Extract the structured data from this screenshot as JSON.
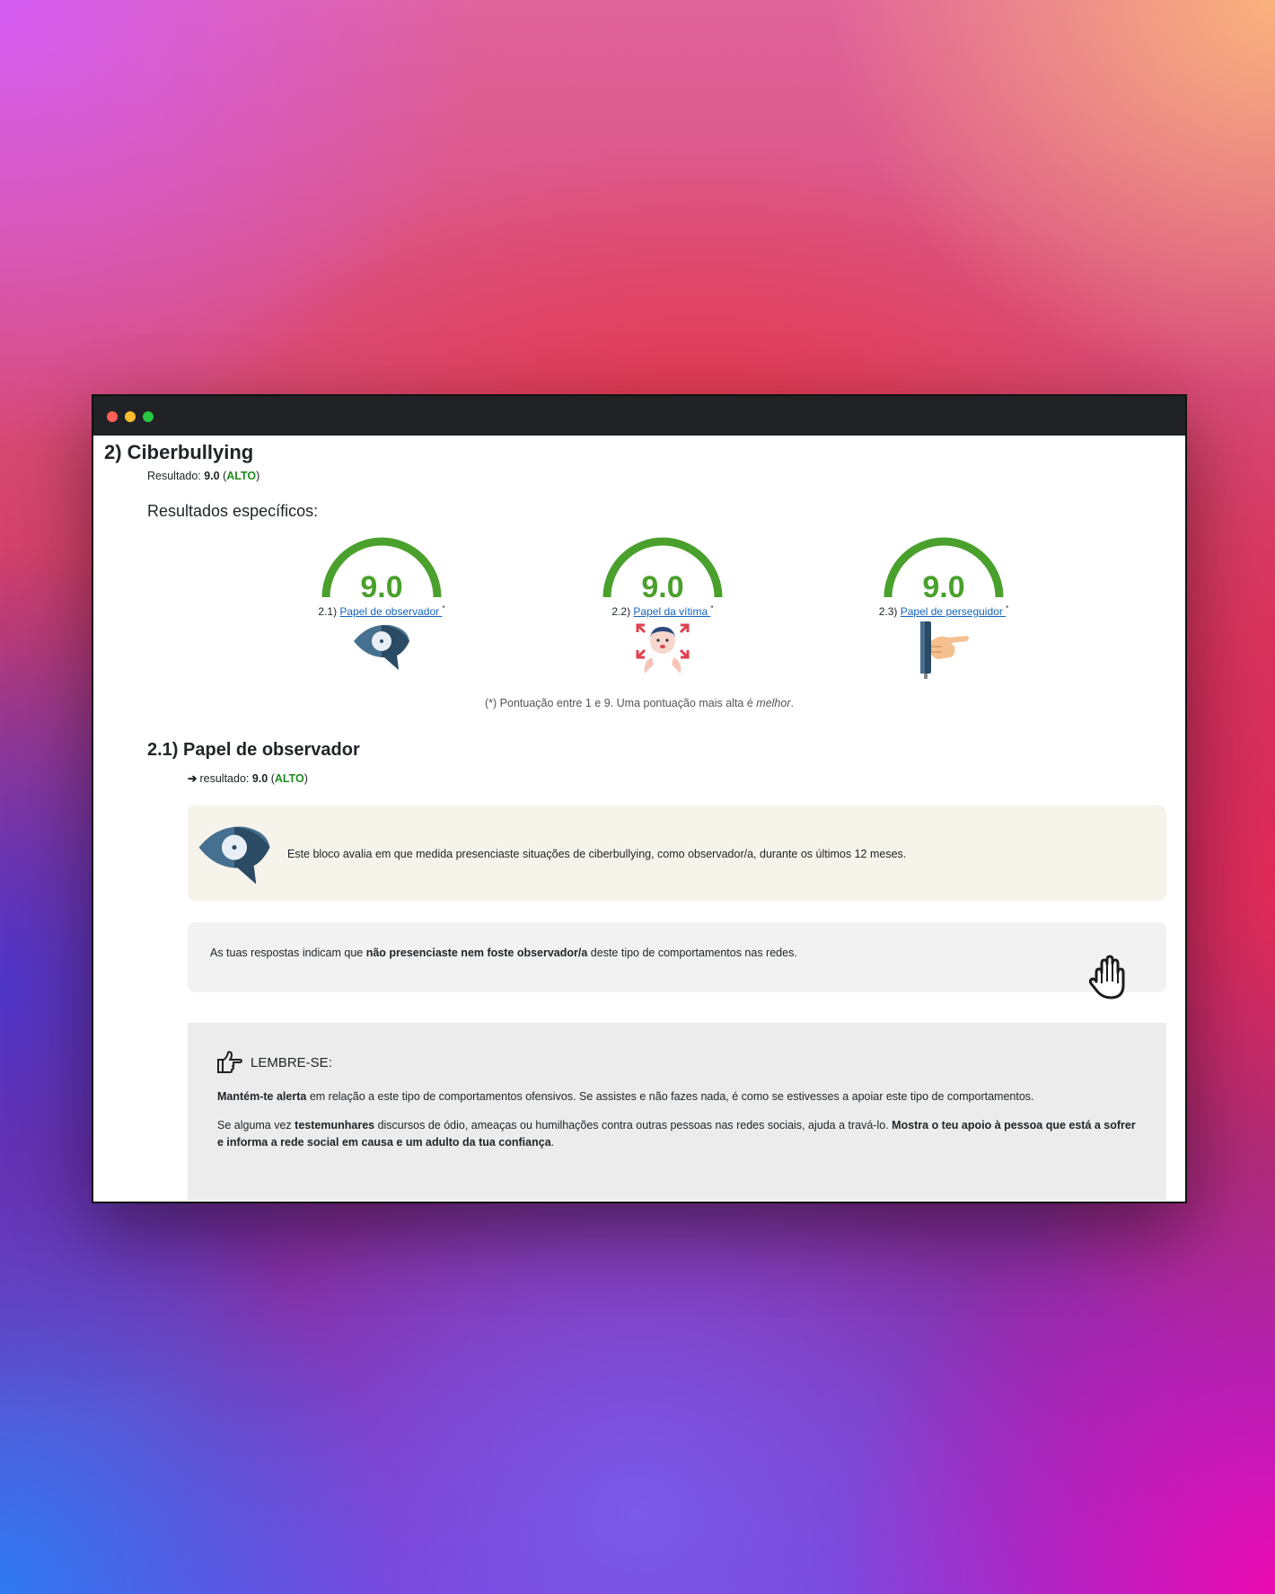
{
  "section": {
    "title": "2) Ciberbullying",
    "result_label": "Resultado: ",
    "result_value": "9.0",
    "result_level": "ALTO",
    "specific_title": "Resultados específicos:"
  },
  "gauges": [
    {
      "value": "9.0",
      "score": 9.0,
      "prefix": "2.1) ",
      "link": "Papel de observador ",
      "star": "*",
      "icon": "eye-icon"
    },
    {
      "value": "9.0",
      "score": 9.0,
      "prefix": "2.2) ",
      "link": "Papel da vítima ",
      "star": "*",
      "icon": "victim-icon"
    },
    {
      "value": "9.0",
      "score": 9.0,
      "prefix": "2.3) ",
      "link": "Papel de perseguidor ",
      "star": "*",
      "icon": "pointing-hand-icon"
    }
  ],
  "footnote": {
    "text": "(*) Pontuação entre 1 e 9. Uma pontuação mais alta é ",
    "emph": "melhor",
    "end": "."
  },
  "subsection": {
    "title": "2.1) Papel de observador",
    "result_label": "resultado: ",
    "result_value": "9.0",
    "result_level": "ALTO"
  },
  "info_box": {
    "text": "Este bloco avalia em que medida presenciaste situações de ciberbullying, como observador/a, durante os últimos 12 meses."
  },
  "result_box": {
    "before": "As tuas respostas indicam que ",
    "bold": "não presenciaste nem foste observador/a",
    "after": " deste tipo de comportamentos nas redes."
  },
  "remember_box": {
    "heading": "LEMBRE-SE:",
    "p1_bold": "Mantém-te alerta",
    "p1_rest": " em relação a este tipo de comportamentos ofensivos. Se assistes e não fazes nada, é como se estivesses a apoiar este tipo de comportamentos.",
    "p2_a": "Se alguma vez ",
    "p2_bold1": "testemunhares",
    "p2_b": " discursos de ódio, ameaças ou humilhações contra outras pessoas nas redes sociais, ajuda a travá-lo. ",
    "p2_bold2": "Mostra o teu apoio à pessoa que está a sofrer e informa a rede social em causa e um adulto da tua confiança",
    "p2_end": "."
  },
  "colors": {
    "gauge": "#4aa02c",
    "level": "#1f8a1f",
    "link": "#1565c0"
  }
}
